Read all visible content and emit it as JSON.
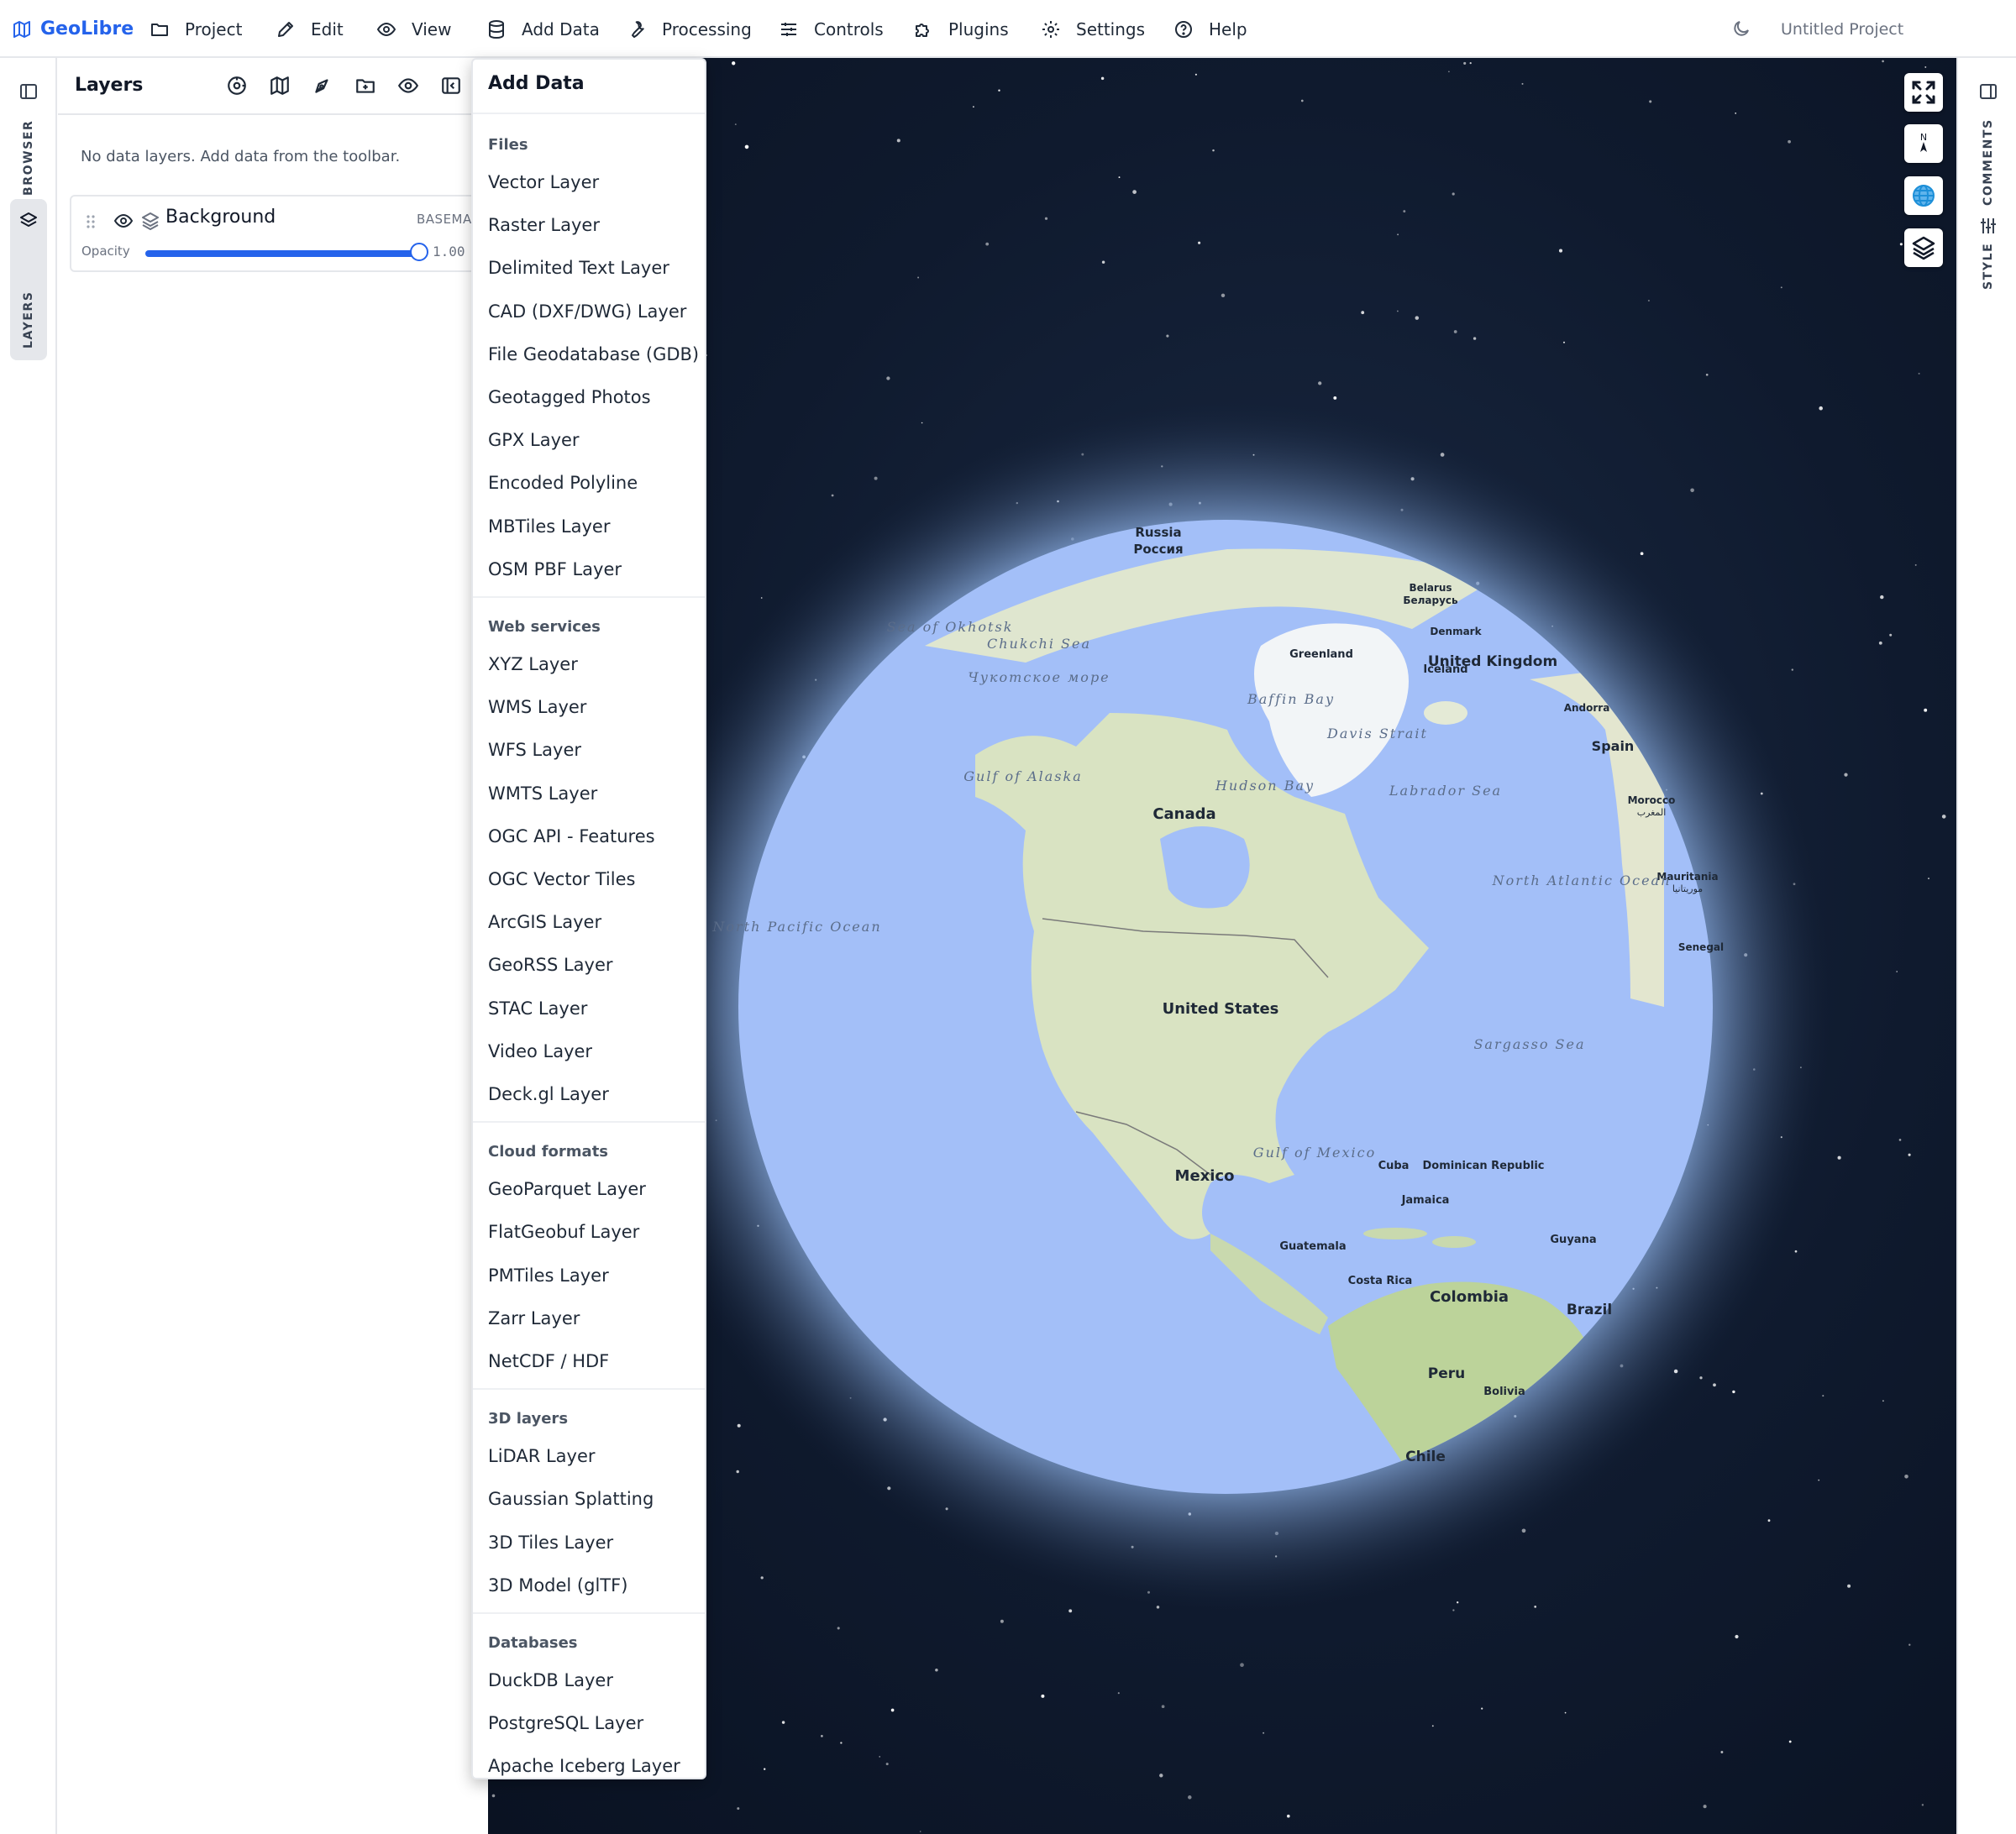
{
  "menubar": {
    "brand": "GeoLibre",
    "items": [
      {
        "label": "Project",
        "icon": "folder-icon"
      },
      {
        "label": "Edit",
        "icon": "pencil-icon"
      },
      {
        "label": "View",
        "icon": "eye-icon"
      },
      {
        "label": "Add Data",
        "icon": "database-icon"
      },
      {
        "label": "Processing",
        "icon": "wrench-icon"
      },
      {
        "label": "Controls",
        "icon": "sliders-icon"
      },
      {
        "label": "Plugins",
        "icon": "puzzle-icon"
      },
      {
        "label": "Settings",
        "icon": "gear-icon"
      },
      {
        "label": "Help",
        "icon": "help-icon"
      }
    ],
    "theme_icon": "moon-icon",
    "project_name": "Untitled Project"
  },
  "left_rail": {
    "tabs": [
      {
        "label": "BROWSER",
        "icon": "sidebar-icon",
        "active": false
      },
      {
        "label": "LAYERS",
        "icon": "layers-icon",
        "active": true
      }
    ]
  },
  "right_rail": {
    "tabs": [
      {
        "label": "COMMENTS",
        "icon": "sidebar-icon"
      },
      {
        "label": "STYLE",
        "icon": "sliders-icon"
      }
    ]
  },
  "layers_panel": {
    "title": "Layers",
    "empty_message": "No data layers. Add data from the toolbar.",
    "layers": [
      {
        "name": "Background",
        "type": "BASEMAP",
        "visible": true,
        "opacity_label": "Opacity",
        "opacity": 1.0,
        "opacity_text": "1.00"
      }
    ]
  },
  "add_data_menu": {
    "title": "Add Data",
    "sections": [
      {
        "heading": "Files",
        "items": [
          "Vector Layer",
          "Raster Layer",
          "Delimited Text Layer",
          "CAD (DXF/DWG) Layer",
          "File Geodatabase (GDB)",
          "Geotagged Photos",
          "GPX Layer",
          "Encoded Polyline",
          "MBTiles Layer",
          "OSM PBF Layer"
        ]
      },
      {
        "heading": "Web services",
        "items": [
          "XYZ Layer",
          "WMS Layer",
          "WFS Layer",
          "WMTS Layer",
          "OGC API - Features",
          "OGC Vector Tiles",
          "ArcGIS Layer",
          "GeoRSS Layer",
          "STAC Layer",
          "Video Layer",
          "Deck.gl Layer"
        ]
      },
      {
        "heading": "Cloud formats",
        "items": [
          "GeoParquet Layer",
          "FlatGeobuf Layer",
          "PMTiles Layer",
          "Zarr Layer",
          "NetCDF / HDF"
        ]
      },
      {
        "heading": "3D layers",
        "items": [
          "LiDAR Layer",
          "Gaussian Splatting",
          "3D Tiles Layer",
          "3D Model (glTF)"
        ]
      },
      {
        "heading": "Databases",
        "items": [
          "DuckDB Layer",
          "PostgreSQL Layer",
          "Apache Iceberg Layer"
        ]
      }
    ]
  },
  "map": {
    "controls": [
      "fullscreen-icon",
      "compass-north-icon",
      "globe-icon",
      "layers-icon"
    ],
    "compass_label": "N",
    "labels": {
      "russia": "Russia",
      "russia_native": "Россия",
      "sea_of_okhotsk": "Sea of Okhotsk",
      "chukchi_sea": "Chukchi Sea",
      "chukchi_native": "Чукотское море",
      "belarus": "Belarus",
      "belarus_native": "Беларусь",
      "denmark": "Denmark",
      "greenland": "Greenland",
      "iceland": "Iceland",
      "uk": "United Kingdom",
      "andorra": "Andorra",
      "baffin_bay": "Baffin Bay",
      "davis_strait": "Davis Strait",
      "spain": "Spain",
      "gulf_of_alaska": "Gulf of Alaska",
      "hudson_bay": "Hudson Bay",
      "labrador_sea": "Labrador Sea",
      "morocco": "Morocco",
      "morocco_native": "المغرب",
      "canada": "Canada",
      "north_atlantic": "North Atlantic Ocean",
      "mauritania": "Mauritania",
      "mauritania_native": "موريتانيا",
      "north_pacific": "North Pacific Ocean",
      "senegal": "Senegal",
      "usa": "United States",
      "sargasso": "Sargasso Sea",
      "gulf_of_mexico": "Gulf of Mexico",
      "cuba": "Cuba",
      "dominican": "Dominican Republic",
      "mexico": "Mexico",
      "jamaica": "Jamaica",
      "guatemala": "Guatemala",
      "guyana": "Guyana",
      "costa_rica": "Costa Rica",
      "colombia": "Colombia",
      "brazil": "Brazil",
      "peru": "Peru",
      "bolivia": "Bolivia",
      "chile": "Chile"
    }
  }
}
